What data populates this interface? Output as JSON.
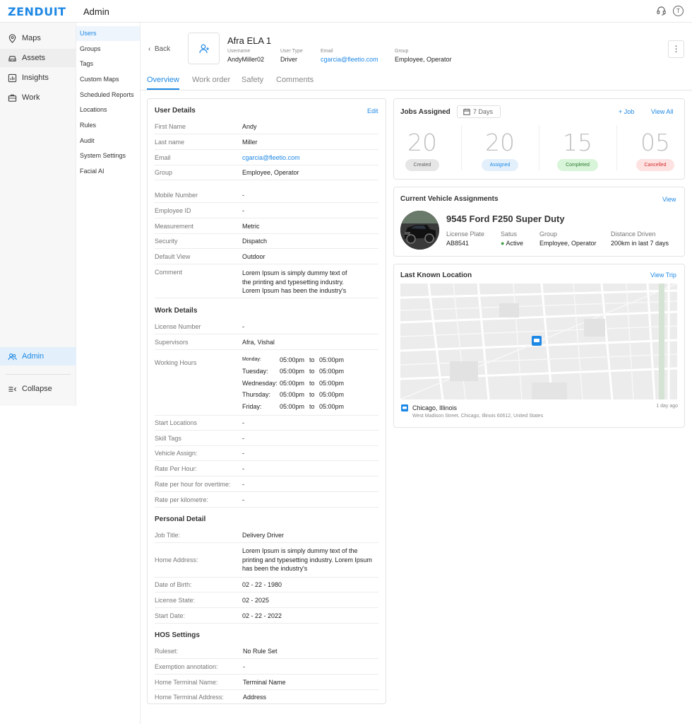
{
  "app": {
    "logo": "ZENDUIT",
    "page_title": "Admin",
    "avatar_initial": "T"
  },
  "nav": {
    "items": [
      {
        "label": "Maps",
        "icon": "map-pin-icon"
      },
      {
        "label": "Assets",
        "icon": "car-icon"
      },
      {
        "label": "Insights",
        "icon": "chart-icon"
      },
      {
        "label": "Work",
        "icon": "briefcase-icon"
      }
    ],
    "admin_label": "Admin",
    "collapse_label": "Collapse"
  },
  "subnav": {
    "items": [
      "Users",
      "Groups",
      "Tags",
      "Custom Maps",
      "Scheduled Reports",
      "Locations",
      "Rules",
      "Audit",
      "System Settings",
      "Facial AI"
    ],
    "active": "Users"
  },
  "header": {
    "back_label": "Back",
    "name": "Afra ELA 1",
    "meta": [
      {
        "label": "Username",
        "value": "AndyMiller02"
      },
      {
        "label": "User Type",
        "value": "Driver"
      },
      {
        "label": "Email",
        "value": "cgarcia@fleetio.com"
      },
      {
        "label": "Group",
        "value": "Employee, Operator"
      }
    ],
    "more_label": "⋮"
  },
  "tabs": [
    "Overview",
    "Work order",
    "Safety",
    "Comments"
  ],
  "user_details": {
    "title": "User Details",
    "edit_label": "Edit",
    "rows_a": [
      {
        "k": "First Name",
        "v": "Andy"
      },
      {
        "k": "Last name",
        "v": "Miller"
      },
      {
        "k": "Email",
        "v": "cgarcia@fleetio.com"
      },
      {
        "k": "Group",
        "v": "Employee, Operator"
      }
    ],
    "rows_b": [
      {
        "k": "Mobile Number",
        "v": "-"
      },
      {
        "k": "Employee ID",
        "v": "-"
      },
      {
        "k": "Measurement",
        "v": "Metric"
      },
      {
        "k": "Security",
        "v": "Dispatch"
      },
      {
        "k": "Default View",
        "v": "Outdoor"
      }
    ],
    "comment_label": "Comment",
    "comment_lines": [
      "Lorem Ipsum is simply dummy text of",
      "the printing and typesetting industry.",
      "Lorem Ipsum has been the industry's"
    ]
  },
  "work_details": {
    "title": "Work Details",
    "rows_a": [
      {
        "k": "License Number",
        "v": "-"
      },
      {
        "k": "Supervisors",
        "v": "Afra, Vishal"
      }
    ],
    "working_hours_label": "Working Hours",
    "hours": [
      {
        "day": "Monday:",
        "from": "05:00pm",
        "to_label": "to",
        "to": "05:00pm"
      },
      {
        "day": "Tuesday:",
        "from": "05:00pm",
        "to_label": "to",
        "to": "05:00pm"
      },
      {
        "day": "Wednesday:",
        "from": "05:00pm",
        "to_label": "to",
        "to": "05:00pm"
      },
      {
        "day": "Thursday:",
        "from": "05:00pm",
        "to_label": "to",
        "to": "05:00pm"
      },
      {
        "day": "Friday:",
        "from": "05:00pm",
        "to_label": "to",
        "to": "05:00pm"
      }
    ],
    "rows_b": [
      {
        "k": "Start Locations",
        "v": "-"
      },
      {
        "k": "Skill Tags",
        "v": "-"
      },
      {
        "k": "Vehicle Assign:",
        "v": "-"
      },
      {
        "k": "Rate Per Hour:",
        "v": "-"
      },
      {
        "k": "Rate per hour for overtime:",
        "v": "-"
      },
      {
        "k": "Rate per kilometre:",
        "v": "-"
      }
    ]
  },
  "personal_detail": {
    "title": "Personal Detail",
    "job_title": {
      "k": "Job Title:",
      "v": "Delivery Driver"
    },
    "home_address_label": "Home Address:",
    "home_address_lines": [
      "Lorem Ipsum is simply dummy text of the",
      "printing and typesetting industry. Lorem Ipsum",
      "has been the industry's"
    ],
    "rows": [
      {
        "k": "Date of Birth:",
        "v": "02 - 22 - 1980"
      },
      {
        "k": "License State:",
        "v": "02 - 2025"
      },
      {
        "k": "Start Date:",
        "v": "02 - 22 - 2022"
      }
    ]
  },
  "hos": {
    "title": "HOS Settings",
    "rows": [
      {
        "k": "Ruleset:",
        "v": "No Rule Set"
      },
      {
        "k": "Exemption annotation:",
        "v": "-"
      },
      {
        "k": "Home Terminal Name:",
        "v": "Terminal Name"
      },
      {
        "k": "Home Terminal Address:",
        "v": "Address"
      }
    ]
  },
  "jobs": {
    "title": "Jobs Assigned",
    "period": "7 Days",
    "add_label": "Job",
    "view_all": "View All",
    "stats": [
      {
        "num": "20",
        "label": "Created",
        "bg": "#e6e6e6",
        "fg": "#666666"
      },
      {
        "num": "20",
        "label": "Assigned",
        "bg": "#e3f0fb",
        "fg": "#1e88e5"
      },
      {
        "num": "15",
        "label": "Completed",
        "bg": "#d9f5d9",
        "fg": "#2e7d32"
      },
      {
        "num": "05",
        "label": "Cancelled",
        "bg": "#fde2e1",
        "fg": "#d32f2f"
      }
    ]
  },
  "vehicle": {
    "title": "Current Vehicle Assignments",
    "view_label": "View",
    "name": "9545 Ford F250 Super Duty",
    "fields": [
      {
        "label": "License Plate",
        "value": "AB8541"
      },
      {
        "label": "Satus",
        "value": "Active"
      },
      {
        "label": "Group",
        "value": "Employee, Operator"
      },
      {
        "label": "Distance Driven",
        "value": "200km in last 7 days"
      }
    ],
    "status_color": "#43a047"
  },
  "location": {
    "title": "Last Known Location",
    "view_trip": "View Trip",
    "city": "Chicago, Illinois",
    "address": "West Madison Street, Chicago, Illinois 60612, United States",
    "ago": "1 day ago"
  },
  "colors": {
    "accent": "#1e88e5"
  }
}
